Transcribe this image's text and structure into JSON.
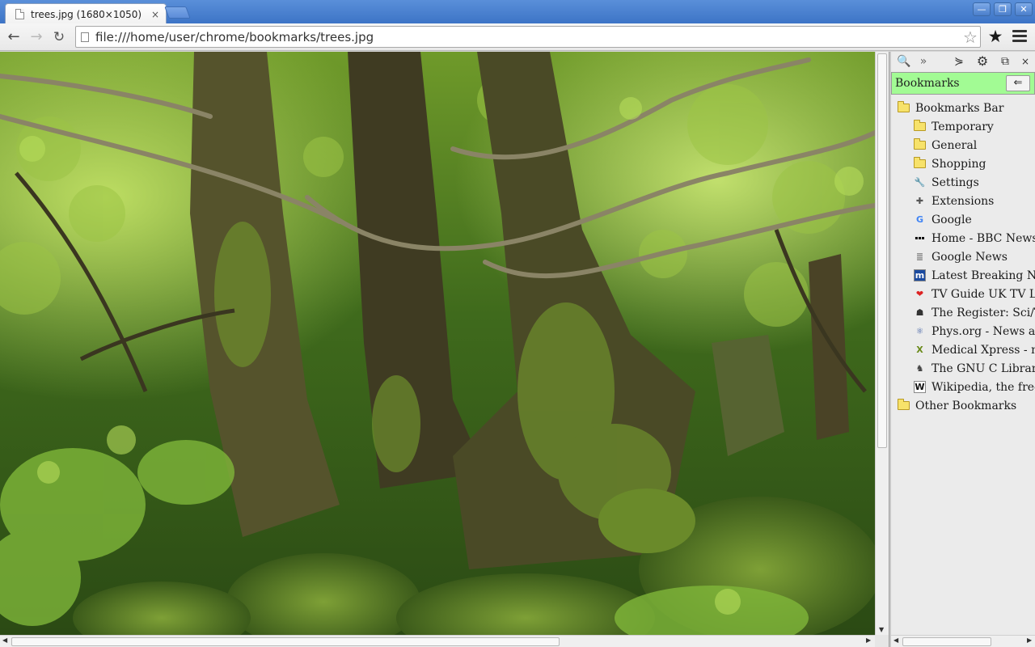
{
  "window": {
    "tab_title": "trees.jpg (1680×1050)",
    "tab_close": "×",
    "min": "—",
    "max": "❐",
    "close": "✕"
  },
  "toolbar": {
    "back": "←",
    "forward": "→",
    "reload": "↻",
    "url": "file:///home/user/chrome/bookmarks/trees.jpg",
    "bookmark_star": "☆",
    "ext_star": "★"
  },
  "content": {
    "image_name": "trees.jpg",
    "image_size": "1680×1050"
  },
  "panel": {
    "tools": {
      "search": "🔍",
      "more": "»",
      "tree": "⋟",
      "gear": "⚙",
      "window": "⧉",
      "close": "×"
    },
    "title": "Bookmarks",
    "back_button": "⇐",
    "items": [
      {
        "label": "Bookmarks Bar",
        "level": 1,
        "icon": "folder-icon"
      },
      {
        "label": "Temporary",
        "level": 2,
        "icon": "folder-icon"
      },
      {
        "label": "General",
        "level": 2,
        "icon": "folder-icon"
      },
      {
        "label": "Shopping",
        "level": 2,
        "icon": "folder-icon"
      },
      {
        "label": "Settings",
        "level": 2,
        "icon": "wrench-icon"
      },
      {
        "label": "Extensions",
        "level": 2,
        "icon": "puzzle-icon"
      },
      {
        "label": "Google",
        "level": 2,
        "icon": "google-icon"
      },
      {
        "label": "Home - BBC News",
        "level": 2,
        "icon": "bbc-icon"
      },
      {
        "label": "Google News",
        "level": 2,
        "icon": "news-icon"
      },
      {
        "label": "Latest Breaking News",
        "level": 2,
        "icon": "m-icon"
      },
      {
        "label": "TV Guide UK TV List",
        "level": 2,
        "icon": "heart-icon"
      },
      {
        "label": "The Register: Sci/Tech",
        "level": 2,
        "icon": "vulture-icon"
      },
      {
        "label": "Phys.org - News and A",
        "level": 2,
        "icon": "atom-icon"
      },
      {
        "label": "Medical Xpress - medi",
        "level": 2,
        "icon": "x-icon"
      },
      {
        "label": "The GNU C Library: R",
        "level": 2,
        "icon": "gnu-icon"
      },
      {
        "label": "Wikipedia, the free enc",
        "level": 2,
        "icon": "wikipedia-icon"
      },
      {
        "label": "Other Bookmarks",
        "level": 1,
        "icon": "folder-icon"
      }
    ]
  }
}
